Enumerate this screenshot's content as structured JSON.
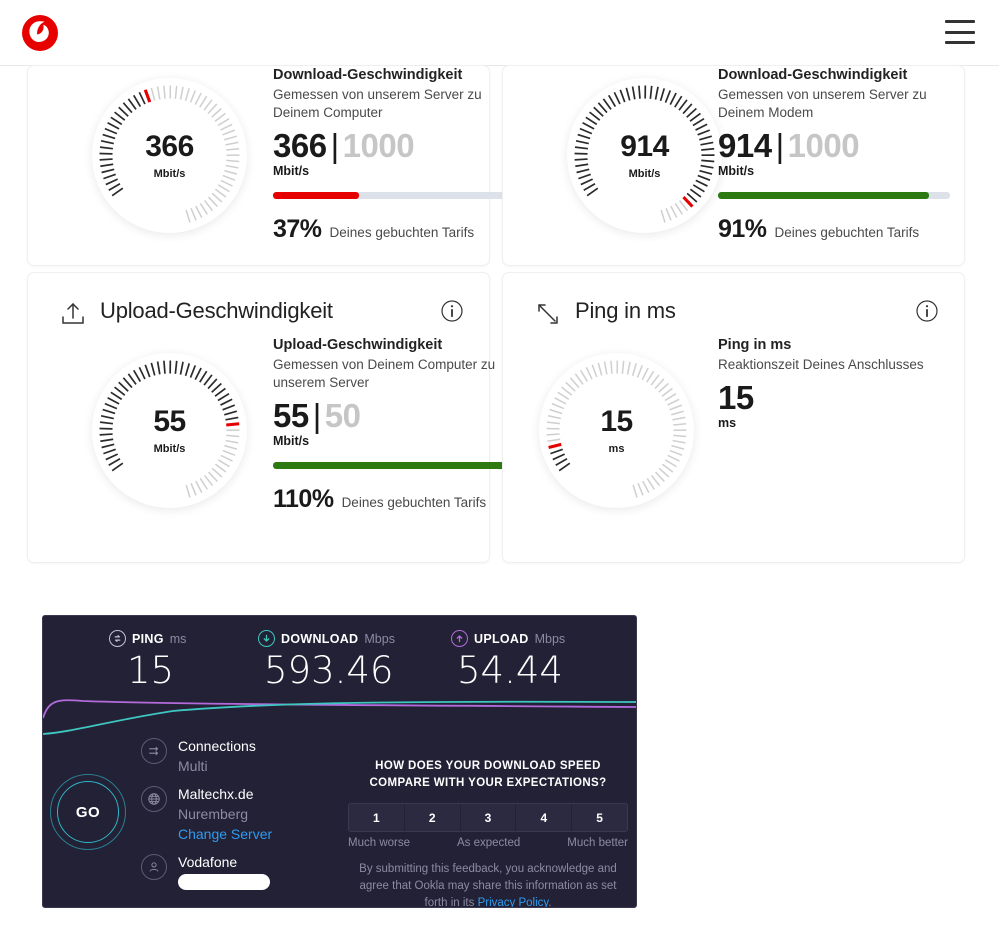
{
  "header": {
    "logo": "vodafone-logo",
    "menu_icon": "hamburger-menu-icon"
  },
  "cards": [
    {
      "id": "download-computer",
      "head_title": "",
      "head_icon": "",
      "gauge": {
        "value": "366",
        "unit": "Mbit/s",
        "fraction": 0.366
      },
      "metric_title": "Download-Geschwindigkeit",
      "metric_sub": "Gemessen von unserem Server zu Deinem Computer",
      "value": "366",
      "separator": "|",
      "max": "1000",
      "unit": "Mbit/s",
      "bar_pct": 37,
      "bar_color": "#e60000",
      "pct_value": "37%",
      "pct_label": "Deines gebuchten Tarifs"
    },
    {
      "id": "download-modem",
      "head_title": "",
      "head_icon": "",
      "gauge": {
        "value": "914",
        "unit": "Mbit/s",
        "fraction": 0.914
      },
      "metric_title": "Download-Geschwindigkeit",
      "metric_sub": "Gemessen von unserem Server zu Deinem Modem",
      "value": "914",
      "separator": "|",
      "max": "1000",
      "unit": "Mbit/s",
      "bar_pct": 91,
      "bar_color": "#2d7a13",
      "pct_value": "91%",
      "pct_label": "Deines gebuchten Tarifs"
    },
    {
      "id": "upload",
      "head_title": "Upload-Geschwindigkeit",
      "head_icon": "upload-icon",
      "gauge": {
        "value": "55",
        "unit": "Mbit/s",
        "fraction": 0.72
      },
      "metric_title": "Upload-Geschwindigkeit",
      "metric_sub": "Gemessen von Deinem Computer zu unserem Server",
      "value": "55",
      "separator": "|",
      "max": "50",
      "unit": "Mbit/s",
      "bar_pct": 100,
      "bar_color": "#2d7a13",
      "pct_value": "110%",
      "pct_label": "Deines gebuchten Tarifs"
    },
    {
      "id": "ping",
      "head_title": "Ping in ms",
      "head_icon": "ping-arrows-icon",
      "gauge": {
        "value": "15",
        "unit": "ms",
        "fraction": 0.075
      },
      "metric_title": "Ping in ms",
      "metric_sub": "Reaktionszeit Deines Anschlusses",
      "value": "15",
      "separator": "",
      "max": "",
      "unit": "ms",
      "bar_pct": 0,
      "bar_color": "",
      "pct_value": "",
      "pct_label": ""
    }
  ],
  "ookla": {
    "metrics": [
      {
        "icon": "ping-circle-icon",
        "label": "PING",
        "unit": "ms",
        "value": "15",
        "color": "#c4c2d4"
      },
      {
        "icon": "download-circle-icon",
        "label": "DOWNLOAD",
        "unit": "Mbps",
        "value": "593.46",
        "color": "#3ec6c0"
      },
      {
        "icon": "upload-circle-icon",
        "label": "UPLOAD",
        "unit": "Mbps",
        "value": "54.44",
        "color": "#b36bdc"
      }
    ],
    "go_label": "GO",
    "connections_label": "Connections",
    "connections_value": "Multi",
    "server_name": "Maltechx.de",
    "server_city": "Nuremberg",
    "change_server_label": "Change Server",
    "isp_name": "Vodafone",
    "isp_redacted": "",
    "feedback_question": "HOW DOES YOUR DOWNLOAD SPEED COMPARE WITH YOUR EXPECTATIONS?",
    "scale": [
      "1",
      "2",
      "3",
      "4",
      "5"
    ],
    "scale_label_low": "Much worse",
    "scale_label_mid": "As expected",
    "scale_label_high": "Much better",
    "legal_text": "By submitting this feedback, you acknowledge and agree that Ookla may share this information as set forth in its ",
    "legal_link": "Privacy Policy",
    "legal_end": ".",
    "accent_teal": "#3ec6c0",
    "accent_purple": "#b36bdc",
    "accent_blue": "#2e9bf0",
    "background": "#232135"
  }
}
